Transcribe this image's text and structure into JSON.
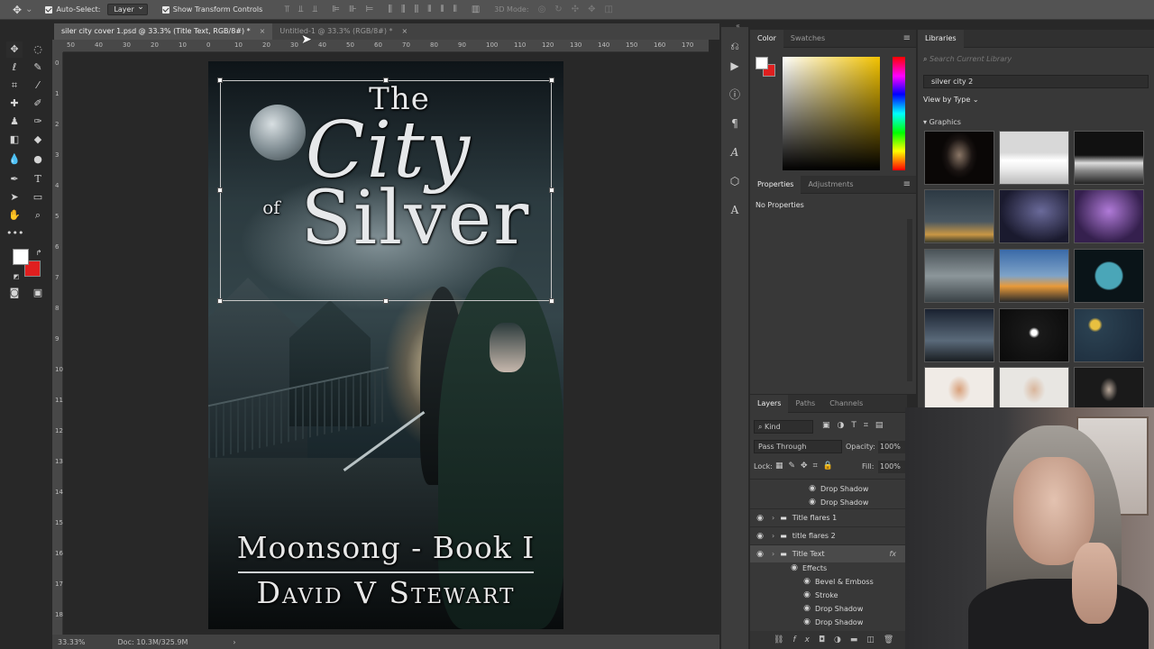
{
  "options_bar": {
    "auto_select_label": "Auto-Select:",
    "auto_select_target": "Layer",
    "show_transform_label": "Show Transform Controls",
    "mode_3d_label": "3D Mode:"
  },
  "doc_tabs": [
    {
      "label": "siler city cover 1.psd @ 33.3% (Title Text, RGB/8#) *",
      "close": "×"
    },
    {
      "label": "Untitled-1 @ 33.3% (RGB/8#) *",
      "close": "×"
    }
  ],
  "ruler": {
    "h_ticks": [
      "50",
      "40",
      "30",
      "20",
      "10",
      "0",
      "10",
      "20",
      "30",
      "40",
      "50",
      "60",
      "70",
      "80",
      "90",
      "100",
      "110",
      "120",
      "130",
      "140",
      "150",
      "160",
      "170"
    ],
    "v_ticks": [
      "0",
      "1",
      "2",
      "3",
      "4",
      "5",
      "6",
      "7",
      "8",
      "9",
      "10",
      "11",
      "12",
      "13",
      "14",
      "15",
      "16",
      "17",
      "18"
    ]
  },
  "cover": {
    "title_the": "The",
    "title_city": "City",
    "title_of": "of",
    "title_silver": "Silver",
    "series": "Moonsong - Book I",
    "author": "David V Stewart"
  },
  "status_bar": {
    "zoom": "33.33%",
    "doc_size": "Doc: 10.3M/325.9M",
    "arrow": "›"
  },
  "color_panel": {
    "tabs": [
      "Color",
      "Swatches"
    ],
    "accent": "#e01f1f"
  },
  "properties_panel": {
    "tabs": [
      "Properties",
      "Adjustments"
    ],
    "message": "No Properties"
  },
  "libraries_panel": {
    "tab": "Libraries",
    "search_placeholder": "Search Current Library",
    "library_name": "silver city 2",
    "view_by": "View by Type",
    "section": "Graphics"
  },
  "layers_panel": {
    "tabs": [
      "Layers",
      "Paths",
      "Channels"
    ],
    "kind_label": "Kind",
    "blend_mode": "Pass Through",
    "opacity_label": "Opacity:",
    "opacity_value": "100%",
    "lock_label": "Lock:",
    "fill_label": "Fill:",
    "fill_value": "100%",
    "rows": [
      {
        "label": "Drop Shadow",
        "type": "effect"
      },
      {
        "label": "Drop Shadow",
        "type": "effect"
      },
      {
        "label": "Title flares 1",
        "type": "group"
      },
      {
        "label": "title flares 2",
        "type": "group"
      },
      {
        "label": "Title Text",
        "type": "group"
      },
      {
        "label": "Effects",
        "type": "effects"
      },
      {
        "label": "Bevel & Emboss",
        "type": "effect"
      },
      {
        "label": "Stroke",
        "type": "effect"
      },
      {
        "label": "Drop Shadow",
        "type": "effect"
      },
      {
        "label": "Drop Shadow",
        "type": "effect"
      }
    ],
    "fx_label": "fx"
  }
}
